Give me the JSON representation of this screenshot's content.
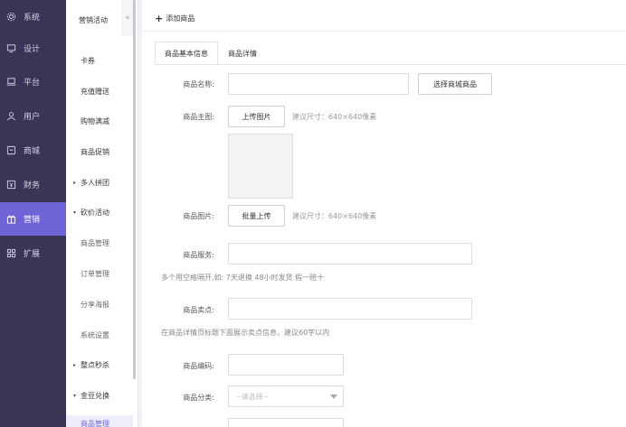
{
  "main_nav": [
    {
      "label": "系统",
      "icon": "gear-icon"
    },
    {
      "label": "设计",
      "icon": "monitor-icon"
    },
    {
      "label": "平台",
      "icon": "laptop-icon"
    },
    {
      "label": "用户",
      "icon": "user-icon"
    },
    {
      "label": "商城",
      "icon": "store-icon"
    },
    {
      "label": "财务",
      "icon": "finance-icon"
    },
    {
      "label": "营销",
      "icon": "gift-icon",
      "active": true
    },
    {
      "label": "扩展",
      "icon": "grid-icon"
    }
  ],
  "sub_nav": {
    "header": "营销活动",
    "collapse_glyph": "«",
    "items": [
      {
        "label": "卡券",
        "type": "item"
      },
      {
        "label": "充值赠送",
        "type": "item"
      },
      {
        "label": "购物满减",
        "type": "item"
      },
      {
        "label": "商品促销",
        "type": "item"
      },
      {
        "label": "多人拼团",
        "type": "group",
        "caret": "▸"
      },
      {
        "label": "砍价活动",
        "type": "group",
        "caret": "▾"
      },
      {
        "label": "商品管理",
        "type": "child"
      },
      {
        "label": "订单管理",
        "type": "child"
      },
      {
        "label": "分享海报",
        "type": "child"
      },
      {
        "label": "系统设置",
        "type": "child"
      },
      {
        "label": "整点秒杀",
        "type": "group",
        "caret": "▸"
      },
      {
        "label": "金豆兑换",
        "type": "group",
        "caret": "▾"
      },
      {
        "label": "商品管理",
        "type": "child",
        "selected": true
      }
    ]
  },
  "content": {
    "add_link": "添加商品",
    "tabs": [
      {
        "label": "商品基本信息",
        "active": true
      },
      {
        "label": "商品详情",
        "active": false
      }
    ],
    "form": {
      "name_label": "商品名称:",
      "name_value": "",
      "select_mall_goods": "选择商城商品",
      "main_image_label": "商品主图:",
      "upload_image": "上传图片",
      "main_image_hint": "建议尺寸：640×640像素",
      "images_label": "商品图片:",
      "batch_upload": "批量上传",
      "images_hint": "建议尺寸：640×640像素",
      "service_label": "商品服务:",
      "service_value": "",
      "service_help": "多个用空格隔开,如: 7天退换 48小时发货 假一赔十",
      "selling_point_label": "商品卖点:",
      "selling_point_value": "",
      "selling_point_help": "在商品详情页标题下面展示卖点信息，建议60字以内",
      "code_label": "商品编码:",
      "code_value": "",
      "category_label": "商品分类:",
      "category_placeholder": "--请选择--"
    }
  },
  "colors": {
    "sidebar_bg": "#3a3555",
    "accent": "#6f63d8"
  }
}
